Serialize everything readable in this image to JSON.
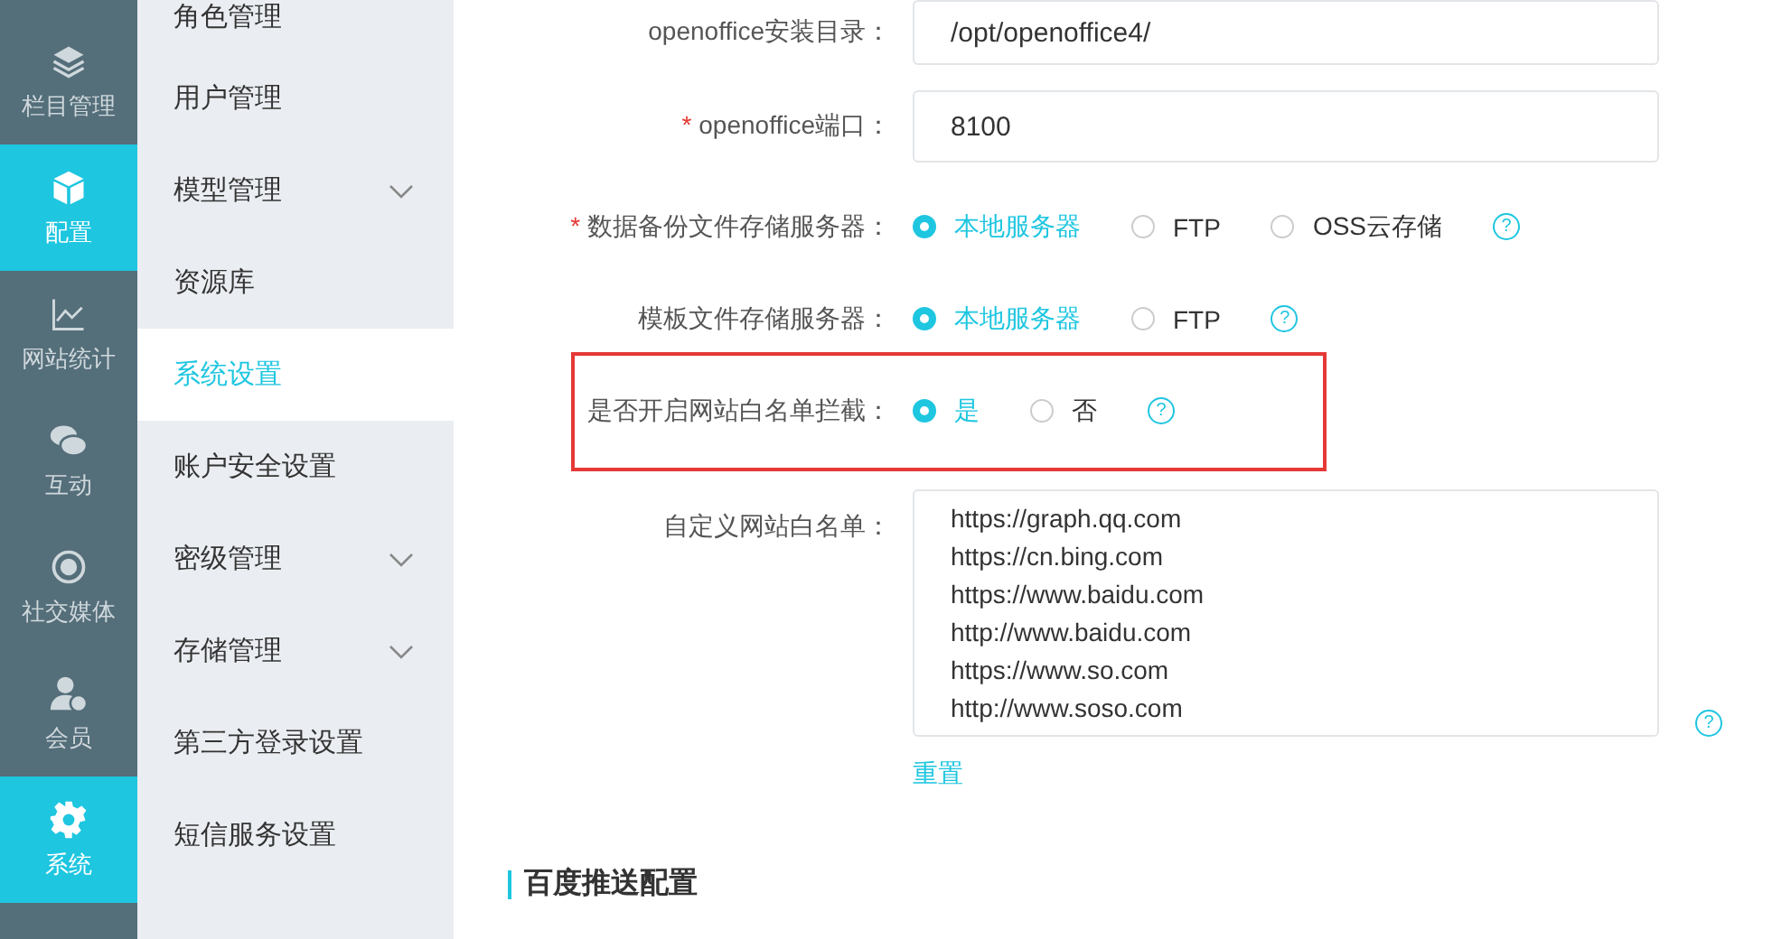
{
  "nav_rail": {
    "items": [
      {
        "label": "栏目管理",
        "selected": false
      },
      {
        "label": "配置",
        "selected": true
      },
      {
        "label": "网站统计",
        "selected": false
      },
      {
        "label": "互动",
        "selected": false
      },
      {
        "label": "社交媒体",
        "selected": false
      },
      {
        "label": "会员",
        "selected": false
      },
      {
        "label": "系统",
        "selected": true
      }
    ]
  },
  "sidebar": {
    "items": [
      {
        "label": "角色管理",
        "selected": false,
        "expandable": false
      },
      {
        "label": "用户管理",
        "selected": false,
        "expandable": false
      },
      {
        "label": "模型管理",
        "selected": false,
        "expandable": true
      },
      {
        "label": "资源库",
        "selected": false,
        "expandable": false
      },
      {
        "label": "系统设置",
        "selected": true,
        "expandable": false
      },
      {
        "label": "账户安全设置",
        "selected": false,
        "expandable": false
      },
      {
        "label": "密级管理",
        "selected": false,
        "expandable": true
      },
      {
        "label": "存储管理",
        "selected": false,
        "expandable": true
      },
      {
        "label": "第三方登录设置",
        "selected": false,
        "expandable": false
      },
      {
        "label": "短信服务设置",
        "selected": false,
        "expandable": false
      }
    ]
  },
  "form": {
    "rows": [
      {
        "kind": "input",
        "label": "openoffice安装目录：",
        "value": "/opt/openoffice4/"
      },
      {
        "kind": "input",
        "required_mark": "*",
        "label": "openoffice端口：",
        "value": "8100"
      },
      {
        "kind": "radio",
        "required_mark": "*",
        "label": "数据备份文件存储服务器：",
        "options": [
          {
            "label": "本地服务器",
            "selected": true
          },
          {
            "label": "FTP",
            "selected": false
          },
          {
            "label": "OSS云存储",
            "selected": false
          }
        ],
        "help": "?"
      },
      {
        "kind": "radio",
        "label": "模板文件存储服务器：",
        "options": [
          {
            "label": "本地服务器",
            "selected": true
          },
          {
            "label": "FTP",
            "selected": false
          }
        ],
        "help": "?"
      },
      {
        "kind": "radio",
        "label": "是否开启网站白名单拦截：",
        "highlighted": true,
        "options": [
          {
            "label": "是",
            "selected": true
          },
          {
            "label": "否",
            "selected": false
          }
        ],
        "help": "?"
      },
      {
        "kind": "textarea",
        "label": "自定义网站白名单：",
        "lines": [
          "https://graph.qq.com",
          "https://cn.bing.com",
          "https://www.baidu.com",
          "http://www.baidu.com",
          "https://www.so.com",
          "http://www.soso.com"
        ],
        "help": "?",
        "link": "重置"
      }
    ]
  },
  "section_heading": "百度推送配置"
}
